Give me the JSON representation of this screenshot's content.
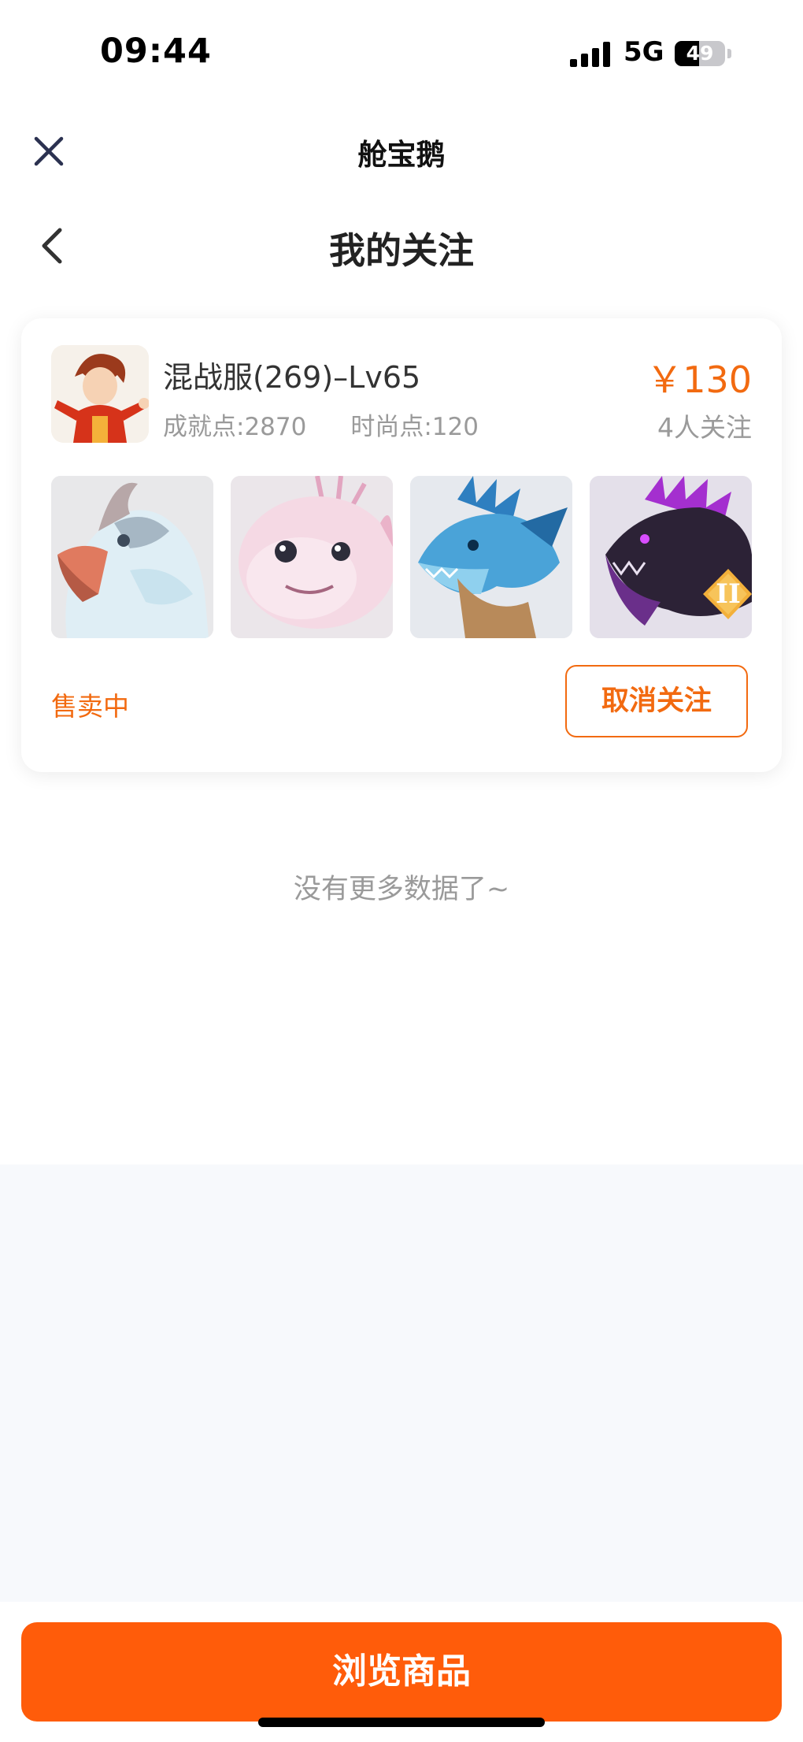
{
  "status_bar": {
    "time": "09:44",
    "network": "5G",
    "battery": "49",
    "battery_level": 0.49
  },
  "mini_program": {
    "title": "舱宝鹅"
  },
  "nav": {
    "title": "我的关注"
  },
  "item": {
    "server": "混战服(269)–Lv65",
    "achievement": "成就点:2870",
    "fashion": "时尚点:120",
    "price": "￥130",
    "followers": "4人关注",
    "status": "售卖中",
    "unfollow_label": "取消关注",
    "thumbnails": [
      "griffin-pet-thumbnail",
      "pink-creature-pet-thumbnail",
      "blue-dragon-pet-thumbnail",
      "purple-dragon-pet-thumbnail"
    ],
    "badge": "II"
  },
  "footer_note": "没有更多数据了~",
  "bottom": {
    "browse_label": "浏览商品"
  },
  "colors": {
    "accent": "#f26a10",
    "button": "#ff5c0a"
  },
  "icons": [
    "close-icon",
    "back-icon",
    "signal-icon",
    "battery-icon"
  ]
}
